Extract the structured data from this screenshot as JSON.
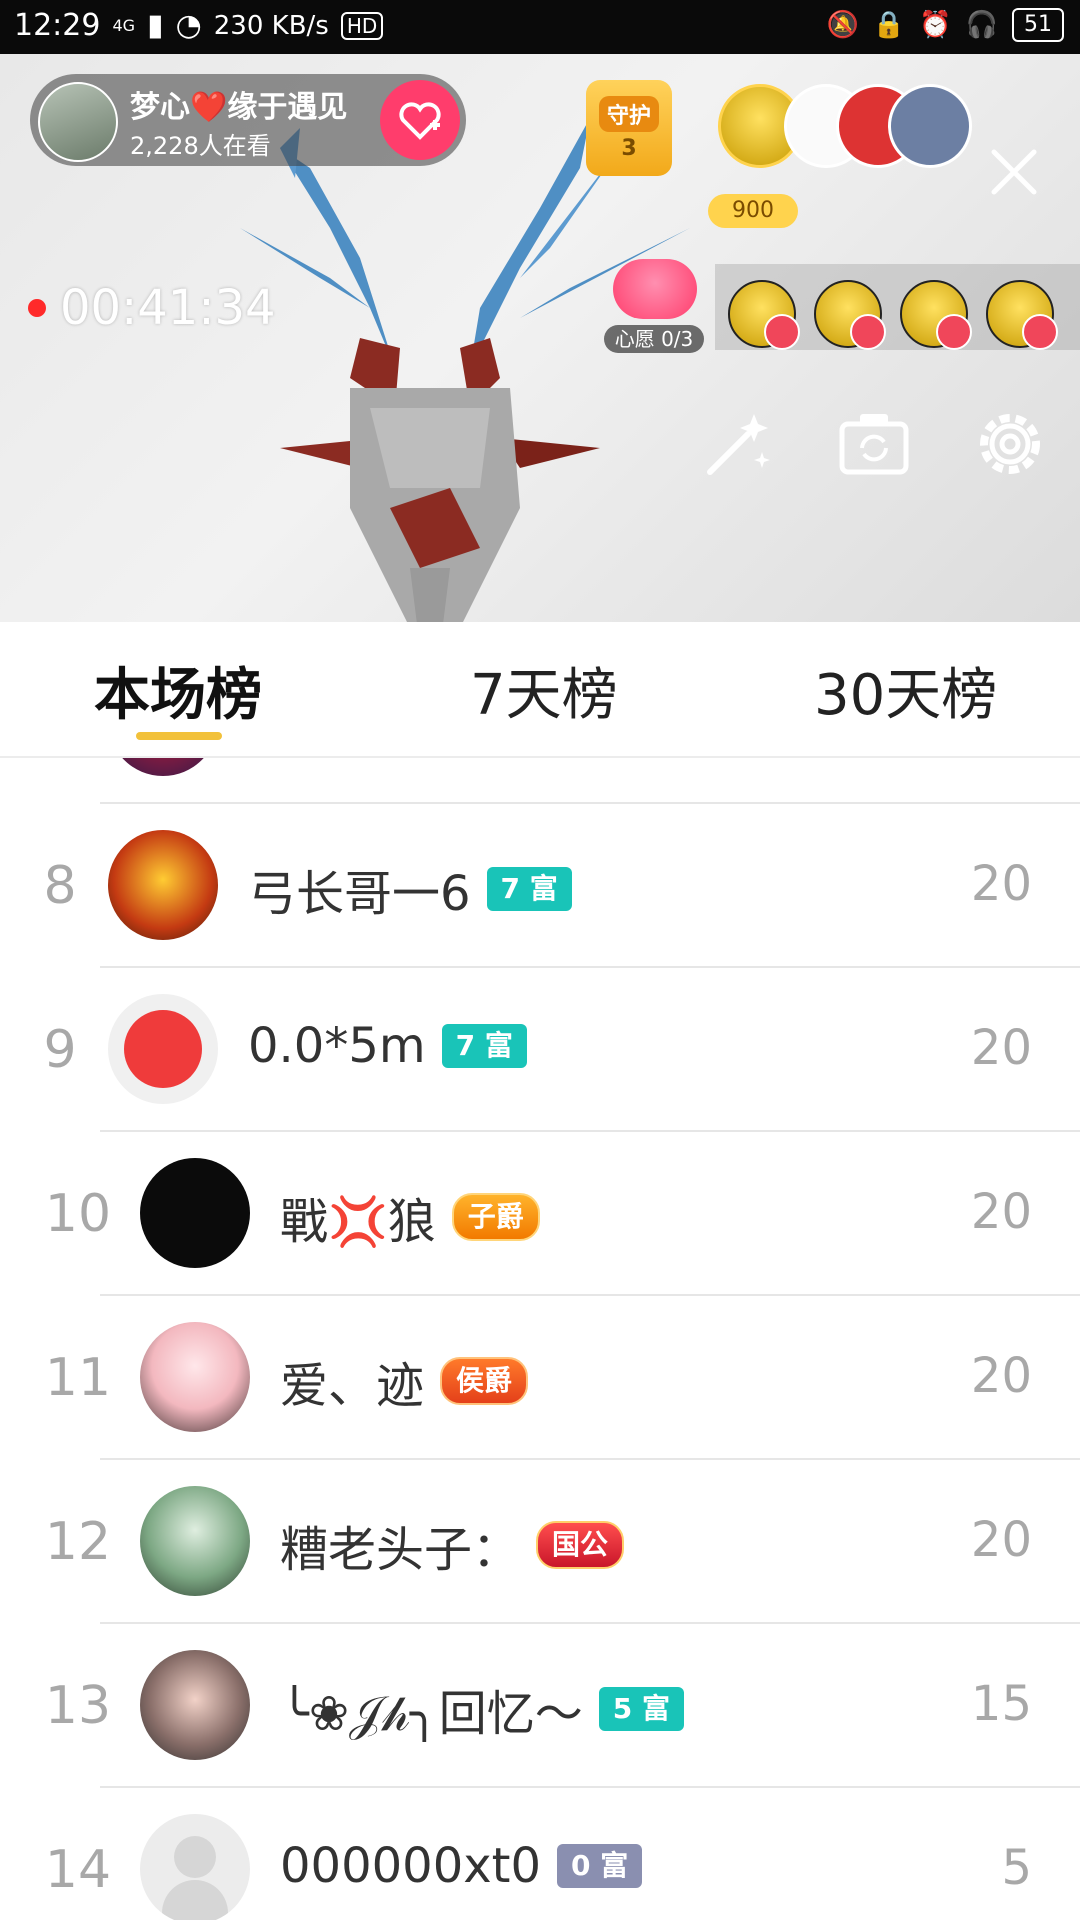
{
  "status_bar": {
    "time": "12:29",
    "network": "4G",
    "speed": "230 KB/s",
    "hd": "HD",
    "battery": "51"
  },
  "live": {
    "host_name": "梦心❤️缘于遇见",
    "viewers": "2,228人在看",
    "guard_label": "守护",
    "guard_count": "3",
    "top_coin": "900",
    "timer": "00:41:34",
    "wish_label": "心愿 0/3"
  },
  "tabs": [
    "本场榜",
    "7天榜",
    "30天榜"
  ],
  "ranking": [
    {
      "rank": "8",
      "name": "弓长哥一6",
      "badge": "7 富",
      "badge_type": "rich",
      "score": "20"
    },
    {
      "rank": "9",
      "name": "0.0*5m",
      "badge": "7 富",
      "badge_type": "rich",
      "score": "20"
    },
    {
      "rank": "10",
      "name": "戰💢狼",
      "badge": "子爵",
      "badge_type": "noble-orange",
      "score": "20"
    },
    {
      "rank": "11",
      "name": "爱、迹",
      "badge": "侯爵",
      "badge_type": "noble-red",
      "score": "20"
    },
    {
      "rank": "12",
      "name": "糟老头子：",
      "badge": "国公",
      "badge_type": "noble-crimson",
      "score": "20"
    },
    {
      "rank": "13",
      "name": "╰❀𝒥𝒽╮回忆～",
      "badge": "5 富",
      "badge_type": "rich",
      "score": "15"
    },
    {
      "rank": "14",
      "name": "000000xt0",
      "badge": "0 富",
      "badge_type": "grey",
      "score": "5"
    }
  ]
}
